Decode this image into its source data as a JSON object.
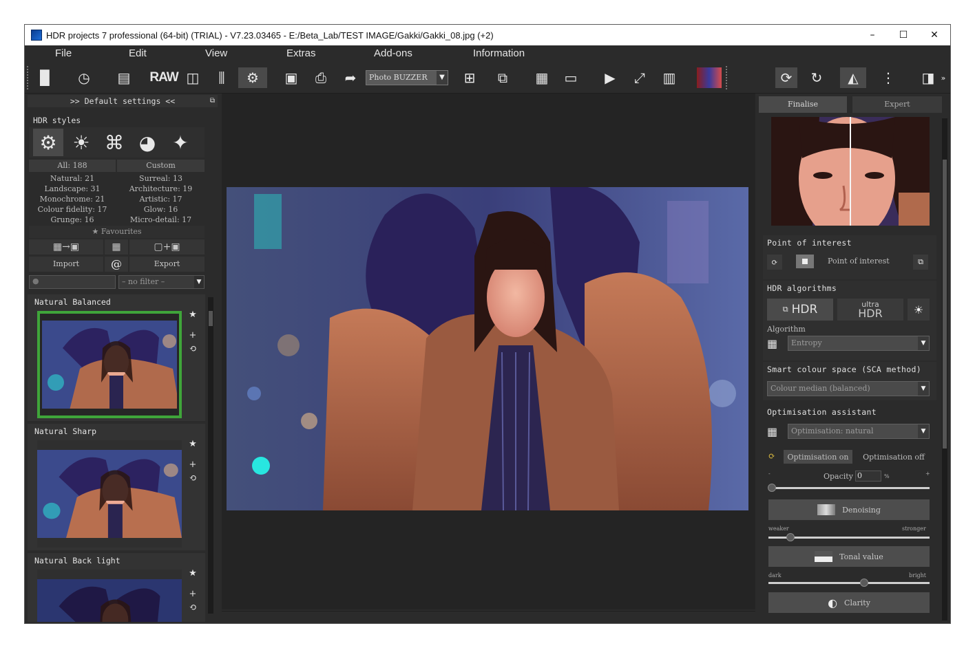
{
  "window": {
    "title": "HDR projects 7 professional (64-bit) (TRIAL) - V7.23.03465 - E:/Beta_Lab/TEST IMAGE/Gakki/Gakki_08.jpg (+2)",
    "minimize": "–",
    "maximize": "☐",
    "close": "✕"
  },
  "menu": [
    "File",
    "Edit",
    "View",
    "Extras",
    "Add-ons",
    "Information"
  ],
  "toolbar": {
    "raw_label": "RAW",
    "preset_select": "Photo BUZZER"
  },
  "left": {
    "header": ">> Default settings <<",
    "hdr_styles_label": "HDR styles",
    "cat_all": "All: 188",
    "cat_custom": "Custom",
    "categories": [
      "Natural: 21",
      "Surreal: 13",
      "Landscape: 31",
      "Architecture: 19",
      "Monochrome: 21",
      "Artistic: 17",
      "Colour fidelity: 17",
      "Glow: 16",
      "Grunge: 16",
      "Micro-detail: 17"
    ],
    "favourites": "Favourites",
    "import": "Import",
    "export": "Export",
    "at": "@",
    "filter": "– no filter –",
    "presets": [
      "Natural Balanced",
      "Natural Sharp",
      "Natural Back light"
    ]
  },
  "right": {
    "tabs": [
      "Finalise",
      "Expert"
    ],
    "poi_label": "Point of interest",
    "poi_button": "Point of interest",
    "hdr_algorithms_label": "HDR algorithms",
    "hdr_button": "HDR",
    "ultra_top": "ultra",
    "ultra_bottom": "HDR",
    "algorithm_label": "Algorithm",
    "algorithm_value": "Entropy",
    "sca_label": "Smart colour space (SCA method)",
    "sca_value": "Colour median (balanced)",
    "optim_label": "Optimisation assistant",
    "optim_value": "Optimisation: natural",
    "optim_on": "Optimisation on",
    "optim_off": "Optimisation off",
    "opacity_label": "Opacity",
    "opacity_value": "0",
    "opacity_unit": "%",
    "minus": "-",
    "plus": "+",
    "denoising": "Denoising",
    "weaker": "weaker",
    "stronger": "stronger",
    "tonal": "Tonal value",
    "dark": "dark",
    "bright": "bright",
    "clarity": "Clarity"
  }
}
